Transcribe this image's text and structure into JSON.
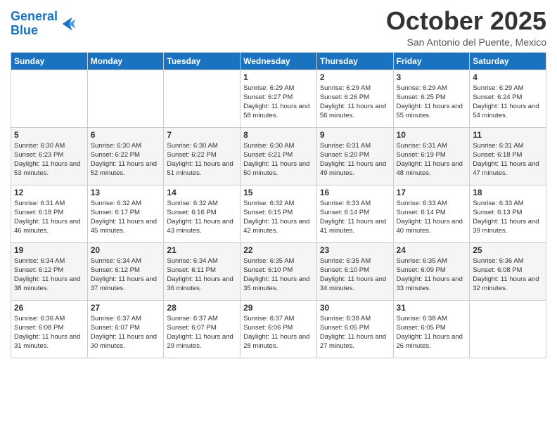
{
  "logo": {
    "line1": "General",
    "line2": "Blue"
  },
  "header": {
    "month": "October 2025",
    "location": "San Antonio del Puente, Mexico"
  },
  "weekdays": [
    "Sunday",
    "Monday",
    "Tuesday",
    "Wednesday",
    "Thursday",
    "Friday",
    "Saturday"
  ],
  "weeks": [
    [
      {
        "day": "",
        "sunrise": "",
        "sunset": "",
        "daylight": ""
      },
      {
        "day": "",
        "sunrise": "",
        "sunset": "",
        "daylight": ""
      },
      {
        "day": "",
        "sunrise": "",
        "sunset": "",
        "daylight": ""
      },
      {
        "day": "1",
        "sunrise": "Sunrise: 6:29 AM",
        "sunset": "Sunset: 6:27 PM",
        "daylight": "Daylight: 11 hours and 58 minutes."
      },
      {
        "day": "2",
        "sunrise": "Sunrise: 6:29 AM",
        "sunset": "Sunset: 6:26 PM",
        "daylight": "Daylight: 11 hours and 56 minutes."
      },
      {
        "day": "3",
        "sunrise": "Sunrise: 6:29 AM",
        "sunset": "Sunset: 6:25 PM",
        "daylight": "Daylight: 11 hours and 55 minutes."
      },
      {
        "day": "4",
        "sunrise": "Sunrise: 6:29 AM",
        "sunset": "Sunset: 6:24 PM",
        "daylight": "Daylight: 11 hours and 54 minutes."
      }
    ],
    [
      {
        "day": "5",
        "sunrise": "Sunrise: 6:30 AM",
        "sunset": "Sunset: 6:23 PM",
        "daylight": "Daylight: 11 hours and 53 minutes."
      },
      {
        "day": "6",
        "sunrise": "Sunrise: 6:30 AM",
        "sunset": "Sunset: 6:22 PM",
        "daylight": "Daylight: 11 hours and 52 minutes."
      },
      {
        "day": "7",
        "sunrise": "Sunrise: 6:30 AM",
        "sunset": "Sunset: 6:22 PM",
        "daylight": "Daylight: 11 hours and 51 minutes."
      },
      {
        "day": "8",
        "sunrise": "Sunrise: 6:30 AM",
        "sunset": "Sunset: 6:21 PM",
        "daylight": "Daylight: 11 hours and 50 minutes."
      },
      {
        "day": "9",
        "sunrise": "Sunrise: 6:31 AM",
        "sunset": "Sunset: 6:20 PM",
        "daylight": "Daylight: 11 hours and 49 minutes."
      },
      {
        "day": "10",
        "sunrise": "Sunrise: 6:31 AM",
        "sunset": "Sunset: 6:19 PM",
        "daylight": "Daylight: 11 hours and 48 minutes."
      },
      {
        "day": "11",
        "sunrise": "Sunrise: 6:31 AM",
        "sunset": "Sunset: 6:18 PM",
        "daylight": "Daylight: 11 hours and 47 minutes."
      }
    ],
    [
      {
        "day": "12",
        "sunrise": "Sunrise: 6:31 AM",
        "sunset": "Sunset: 6:18 PM",
        "daylight": "Daylight: 11 hours and 46 minutes."
      },
      {
        "day": "13",
        "sunrise": "Sunrise: 6:32 AM",
        "sunset": "Sunset: 6:17 PM",
        "daylight": "Daylight: 11 hours and 45 minutes."
      },
      {
        "day": "14",
        "sunrise": "Sunrise: 6:32 AM",
        "sunset": "Sunset: 6:16 PM",
        "daylight": "Daylight: 11 hours and 43 minutes."
      },
      {
        "day": "15",
        "sunrise": "Sunrise: 6:32 AM",
        "sunset": "Sunset: 6:15 PM",
        "daylight": "Daylight: 11 hours and 42 minutes."
      },
      {
        "day": "16",
        "sunrise": "Sunrise: 6:33 AM",
        "sunset": "Sunset: 6:14 PM",
        "daylight": "Daylight: 11 hours and 41 minutes."
      },
      {
        "day": "17",
        "sunrise": "Sunrise: 6:33 AM",
        "sunset": "Sunset: 6:14 PM",
        "daylight": "Daylight: 11 hours and 40 minutes."
      },
      {
        "day": "18",
        "sunrise": "Sunrise: 6:33 AM",
        "sunset": "Sunset: 6:13 PM",
        "daylight": "Daylight: 11 hours and 39 minutes."
      }
    ],
    [
      {
        "day": "19",
        "sunrise": "Sunrise: 6:34 AM",
        "sunset": "Sunset: 6:12 PM",
        "daylight": "Daylight: 11 hours and 38 minutes."
      },
      {
        "day": "20",
        "sunrise": "Sunrise: 6:34 AM",
        "sunset": "Sunset: 6:12 PM",
        "daylight": "Daylight: 11 hours and 37 minutes."
      },
      {
        "day": "21",
        "sunrise": "Sunrise: 6:34 AM",
        "sunset": "Sunset: 6:11 PM",
        "daylight": "Daylight: 11 hours and 36 minutes."
      },
      {
        "day": "22",
        "sunrise": "Sunrise: 6:35 AM",
        "sunset": "Sunset: 6:10 PM",
        "daylight": "Daylight: 11 hours and 35 minutes."
      },
      {
        "day": "23",
        "sunrise": "Sunrise: 6:35 AM",
        "sunset": "Sunset: 6:10 PM",
        "daylight": "Daylight: 11 hours and 34 minutes."
      },
      {
        "day": "24",
        "sunrise": "Sunrise: 6:35 AM",
        "sunset": "Sunset: 6:09 PM",
        "daylight": "Daylight: 11 hours and 33 minutes."
      },
      {
        "day": "25",
        "sunrise": "Sunrise: 6:36 AM",
        "sunset": "Sunset: 6:08 PM",
        "daylight": "Daylight: 11 hours and 32 minutes."
      }
    ],
    [
      {
        "day": "26",
        "sunrise": "Sunrise: 6:36 AM",
        "sunset": "Sunset: 6:08 PM",
        "daylight": "Daylight: 11 hours and 31 minutes."
      },
      {
        "day": "27",
        "sunrise": "Sunrise: 6:37 AM",
        "sunset": "Sunset: 6:07 PM",
        "daylight": "Daylight: 11 hours and 30 minutes."
      },
      {
        "day": "28",
        "sunrise": "Sunrise: 6:37 AM",
        "sunset": "Sunset: 6:07 PM",
        "daylight": "Daylight: 11 hours and 29 minutes."
      },
      {
        "day": "29",
        "sunrise": "Sunrise: 6:37 AM",
        "sunset": "Sunset: 6:06 PM",
        "daylight": "Daylight: 11 hours and 28 minutes."
      },
      {
        "day": "30",
        "sunrise": "Sunrise: 6:38 AM",
        "sunset": "Sunset: 6:05 PM",
        "daylight": "Daylight: 11 hours and 27 minutes."
      },
      {
        "day": "31",
        "sunrise": "Sunrise: 6:38 AM",
        "sunset": "Sunset: 6:05 PM",
        "daylight": "Daylight: 11 hours and 26 minutes."
      },
      {
        "day": "",
        "sunrise": "",
        "sunset": "",
        "daylight": ""
      }
    ]
  ]
}
